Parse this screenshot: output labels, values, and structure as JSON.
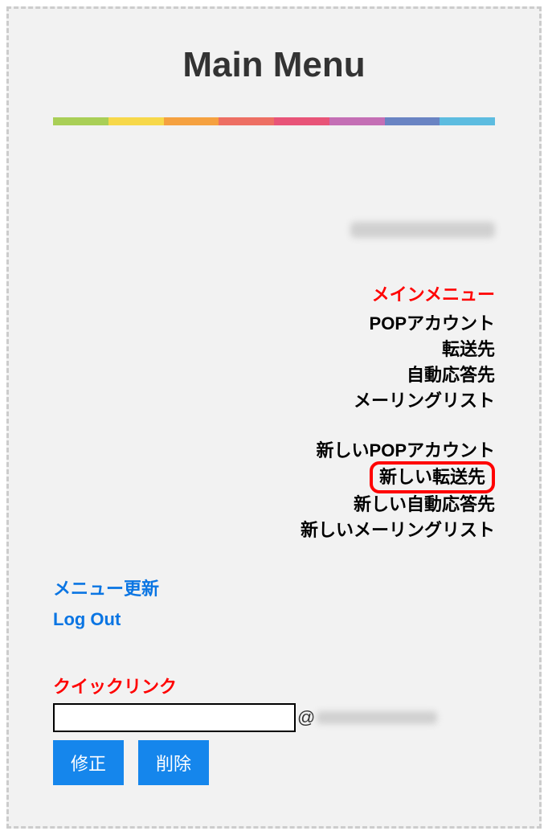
{
  "header": {
    "title": "Main Menu"
  },
  "menu": {
    "header_label": "メインメニュー",
    "items1": [
      "POPアカウント",
      "転送先",
      "自動応答先",
      "メーリングリスト"
    ],
    "items2": [
      "新しいPOPアカウント",
      "新しい転送先",
      "新しい自動応答先",
      "新しいメーリングリスト"
    ],
    "highlighted_index": 1
  },
  "left_links": {
    "refresh_label": "メニュー更新",
    "logout_label": "Log Out"
  },
  "quick_link": {
    "header": "クイックリンク",
    "input_value": "",
    "at_symbol": "@",
    "edit_button": "修正",
    "delete_button": "削除"
  }
}
